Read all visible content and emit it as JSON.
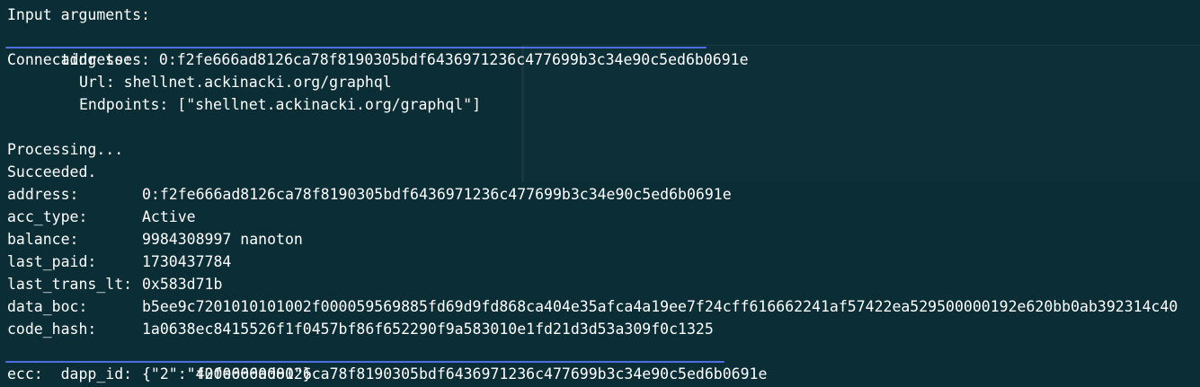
{
  "terminal": {
    "input_header": "Input arguments:",
    "addresses_line": "addresses: 0:f2fe666ad8126ca78f8190305bdf6436971236c477699b3c34e90c5ed6b0691e",
    "connecting_to": "Connecting to:",
    "url_line": "Url: shellnet.ackinacki.org/graphql",
    "endpoints_line": "Endpoints: [\"shellnet.ackinacki.org/graphql\"]",
    "processing": "Processing...",
    "succeeded": "Succeeded.",
    "fields": [
      {
        "key": "address:",
        "value": "0:f2fe666ad8126ca78f8190305bdf6436971236c477699b3c34e90c5ed6b0691e"
      },
      {
        "key": "acc_type:",
        "value": "Active"
      },
      {
        "key": "balance:",
        "value": "9984308997 nanoton"
      },
      {
        "key": "last_paid:",
        "value": "1730437784"
      },
      {
        "key": "last_trans_lt:",
        "value": "0x583d71b"
      },
      {
        "key": "data_boc:",
        "value": "b5ee9c7201010101002f000059569885fd69d9fd868ca404e35afca4a19ee7f24cff616662241af57422ea529500000192e620bb0ab392314c40"
      },
      {
        "key": "code_hash:",
        "value": "1a0638ec8415526f1f0457bf86f652290f9a583010e1fd21d3d53a309f0c1325"
      },
      {
        "key": "dapp_id:",
        "value": "f2fe666ad8126ca78f8190305bdf6436971236c477699b3c34e90c5ed6b0691e"
      },
      {
        "key": "ecc:",
        "value": "{\"2\":\"40000000000\"}"
      }
    ]
  },
  "colors": {
    "background": "#0b2d36",
    "text": "#ffffff",
    "underline": "#4f6fe0"
  }
}
